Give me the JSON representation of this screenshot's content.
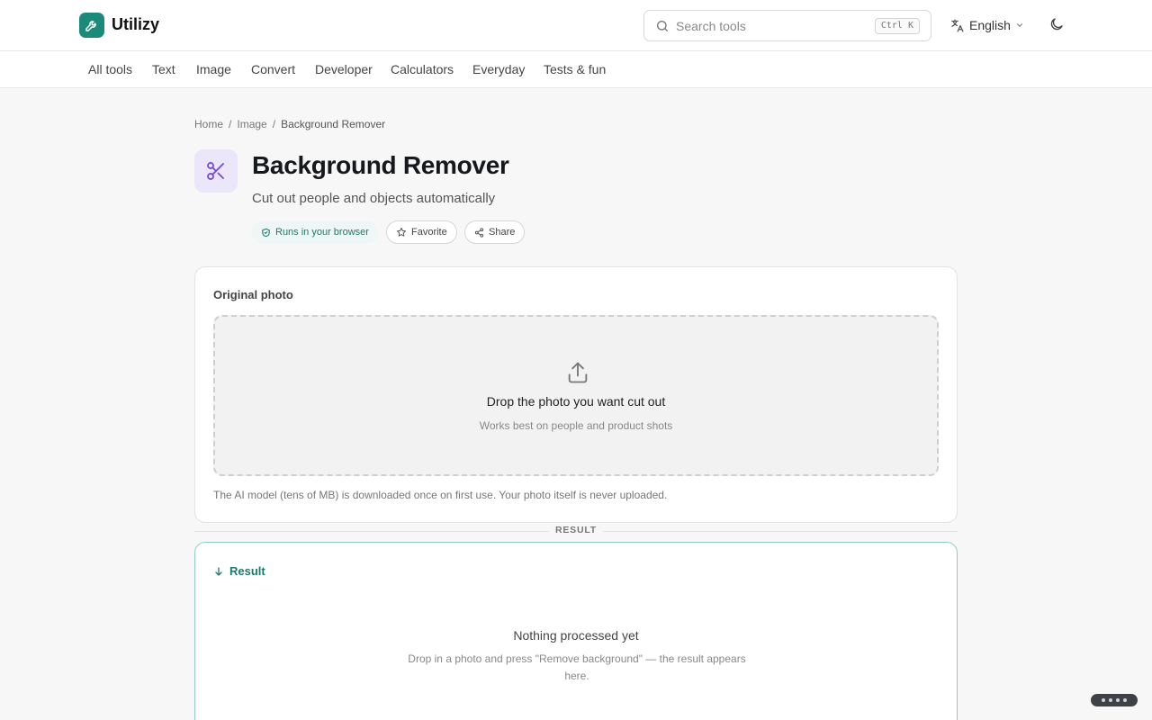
{
  "header": {
    "app_name": "Utilizy",
    "search_placeholder": "Search tools",
    "search_shortcut": "Ctrl K",
    "language": "English"
  },
  "nav": {
    "items": [
      "All tools",
      "Text",
      "Image",
      "Convert",
      "Developer",
      "Calculators",
      "Everyday",
      "Tests & fun"
    ]
  },
  "breadcrumb": {
    "home": "Home",
    "category": "Image",
    "current": "Background Remover",
    "separator": "/"
  },
  "tool": {
    "title": "Background Remover",
    "subtitle": "Cut out people and objects automatically",
    "badge": "Runs in your browser",
    "favorite_label": "Favorite",
    "share_label": "Share",
    "icon": "scissors-icon",
    "icon_color": "#7b4fd0"
  },
  "input_card": {
    "label": "Original photo",
    "drop_title": "Drop the photo you want cut out",
    "drop_subtitle": "Works best on people and product shots",
    "note": "The AI model (tens of MB) is downloaded once on first use. Your photo itself is never uploaded."
  },
  "divider": {
    "label": "RESULT"
  },
  "result_card": {
    "label": "Result",
    "empty_title": "Nothing processed yet",
    "empty_subtitle": "Drop in a photo and press \"Remove background\" — the result appears here."
  },
  "colors": {
    "brand": "#1b8a7a",
    "accent_text": "#1b7a6d",
    "tool_icon_bg": "#ece6fb"
  }
}
